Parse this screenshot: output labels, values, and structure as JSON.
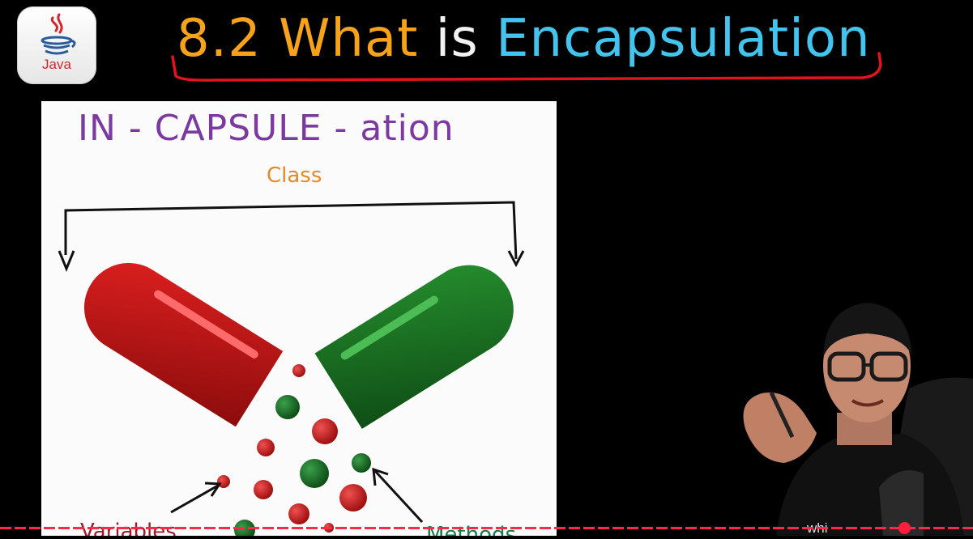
{
  "logo": {
    "label": "Java",
    "icon": "java-cup-icon"
  },
  "title": {
    "number": "8.2",
    "what": "What",
    "is": "is",
    "keyword": "Encapsulation",
    "colors": {
      "number": "#f7a21b",
      "is": "#f2f2f2",
      "keyword": "#43c4ef",
      "underline": "#e0141e"
    }
  },
  "slide": {
    "heading": "IN - CAPSULE - ation",
    "class_label": "Class",
    "variables_label": "Variables",
    "methods_label": "Methods",
    "colors": {
      "heading": "#7b3aa0",
      "class_label": "#e08a2a",
      "variables_label": "#9c1a2a",
      "methods_label": "#1a7a4a",
      "red_capsule": "#c01818",
      "green_capsule": "#1c7a26"
    }
  },
  "presenter": {
    "icon": "presenter-webcam"
  },
  "corner_text": "whi",
  "progress": {
    "played_fraction": 0.93,
    "color": "#ff2a46"
  }
}
